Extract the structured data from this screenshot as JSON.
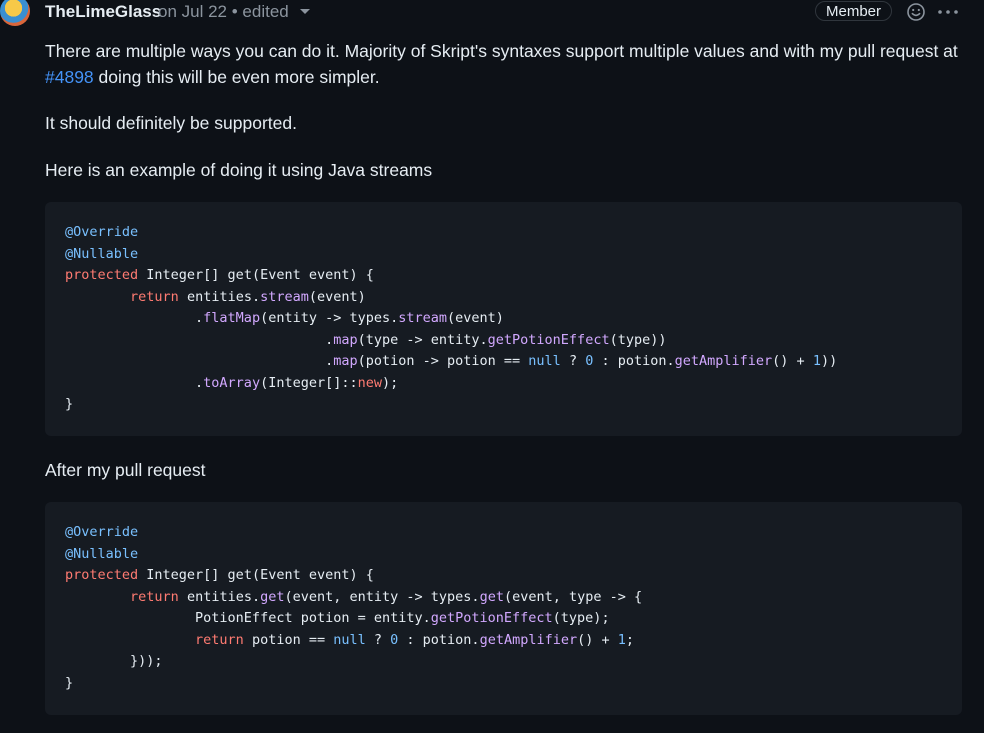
{
  "header": {
    "author": "TheLimeGlass",
    "date": "on Jul 22",
    "separator": "•",
    "edited": "edited",
    "badge": "Member"
  },
  "body": {
    "p1_before": "There are multiple ways you can do it. Majority of Skript's syntaxes support multiple values and with my pull request at ",
    "p1_link": "#4898",
    "p1_after": " doing this will be even more simpler.",
    "p2": "It should definitely be supported.",
    "p3": "Here is an example of doing it using Java streams",
    "p4": "After my pull request"
  },
  "code1": [
    [
      [
        "an",
        "@Override"
      ]
    ],
    [
      [
        "an",
        "@Nullable"
      ]
    ],
    [
      [
        "kw",
        "protected"
      ],
      [
        "",
        "Integer[] get(Event event) {"
      ]
    ],
    [
      [
        "",
        "        "
      ],
      [
        "kw",
        "return"
      ],
      [
        "",
        "entities."
      ],
      [
        "fn",
        "stream"
      ],
      [
        "",
        "(event)"
      ]
    ],
    [
      [
        "",
        "                ."
      ],
      [
        "fn",
        "flatMap"
      ],
      [
        "",
        "(entity -> types."
      ],
      [
        "fn",
        "stream"
      ],
      [
        "",
        "(event)"
      ]
    ],
    [
      [
        "",
        "                                ."
      ],
      [
        "fn",
        "map"
      ],
      [
        "",
        "(type -> entity."
      ],
      [
        "fn",
        "getPotionEffect"
      ],
      [
        "",
        "(type))"
      ]
    ],
    [
      [
        "",
        "                                ."
      ],
      [
        "fn",
        "map"
      ],
      [
        "",
        "(potion -> potion == "
      ],
      [
        "nu",
        "null"
      ],
      [
        "",
        " ? "
      ],
      [
        "nu",
        "0"
      ],
      [
        "",
        " : potion."
      ],
      [
        "fn",
        "getAmplifier"
      ],
      [
        "",
        "() + "
      ],
      [
        "nu",
        "1"
      ],
      [
        "",
        "))"
      ]
    ],
    [
      [
        "",
        "                ."
      ],
      [
        "fn",
        "toArray"
      ],
      [
        "",
        "(Integer[]::"
      ],
      [
        "kw",
        "new"
      ],
      [
        "",
        ");"
      ]
    ],
    [
      [
        "",
        "}"
      ]
    ]
  ],
  "code2": [
    [
      [
        "an",
        "@Override"
      ]
    ],
    [
      [
        "an",
        "@Nullable"
      ]
    ],
    [
      [
        "kw",
        "protected"
      ],
      [
        "",
        "Integer[] get(Event event) {"
      ]
    ],
    [
      [
        "",
        "        "
      ],
      [
        "kw",
        "return"
      ],
      [
        "",
        "entities."
      ],
      [
        "fn",
        "get"
      ],
      [
        "",
        "(event, entity -> types."
      ],
      [
        "fn",
        "get"
      ],
      [
        "",
        "(event, type -> {"
      ]
    ],
    [
      [
        "",
        "                PotionEffect potion = entity."
      ],
      [
        "fn",
        "getPotionEffect"
      ],
      [
        "",
        "(type);"
      ]
    ],
    [
      [
        "",
        "                "
      ],
      [
        "kw",
        "return"
      ],
      [
        "",
        "potion == "
      ],
      [
        "nu",
        "null"
      ],
      [
        "",
        " ? "
      ],
      [
        "nu",
        "0"
      ],
      [
        "",
        " : potion."
      ],
      [
        "fn",
        "getAmplifier"
      ],
      [
        "",
        "() + "
      ],
      [
        "nu",
        "1"
      ],
      [
        "",
        ";"
      ]
    ],
    [
      [
        "",
        "        }));"
      ]
    ],
    [
      [
        "",
        "}"
      ]
    ]
  ]
}
